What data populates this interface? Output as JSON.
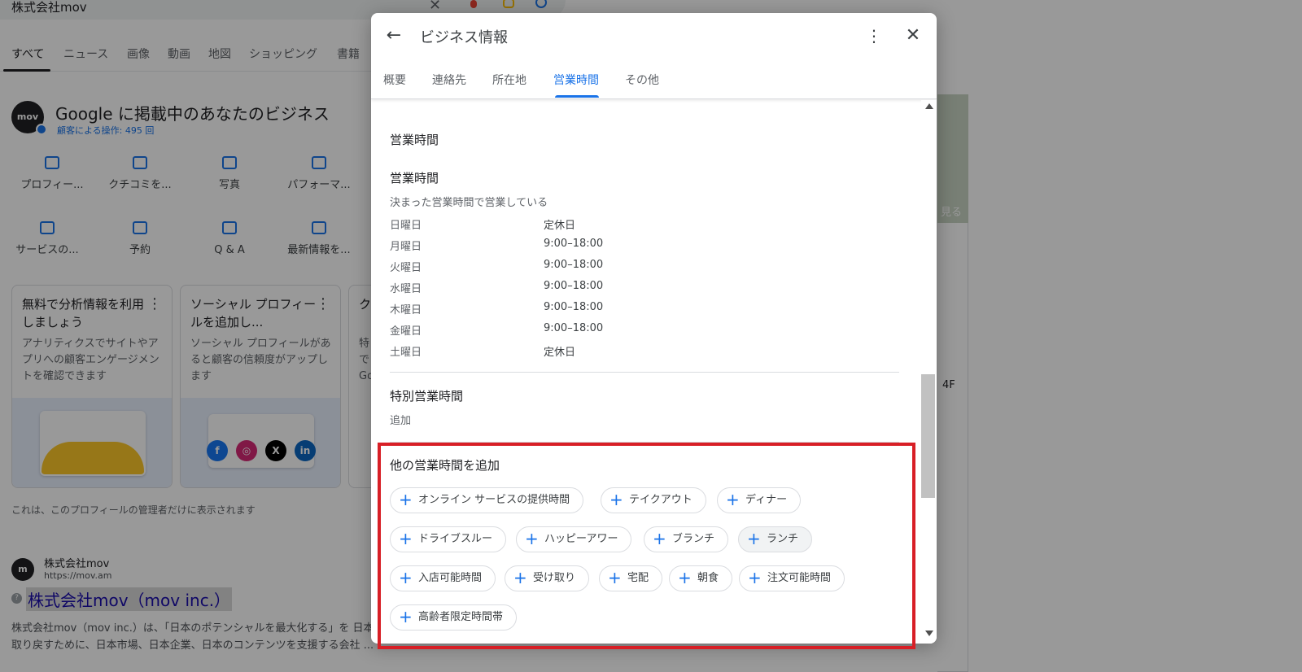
{
  "search": {
    "query": "株式会社mov"
  },
  "search_tabs": [
    "すべて",
    "ニュース",
    "画像",
    "動画",
    "地図",
    "ショッピング",
    "書籍"
  ],
  "business": {
    "avatar": "mov",
    "title": "Google に掲載中のあなたのビジネス",
    "stats": "顧客による操作: 495 回",
    "actions": [
      {
        "label": "プロフィー...",
        "icon": "storefront-icon"
      },
      {
        "label": "クチコミを...",
        "icon": "review-star-icon"
      },
      {
        "label": "写真",
        "icon": "photo-icon"
      },
      {
        "label": "パフォーマ...",
        "icon": "performance-icon"
      },
      {
        "label": "サービスの...",
        "icon": "list-icon"
      },
      {
        "label": "予約",
        "icon": "calendar-icon"
      },
      {
        "label": "Q & A",
        "icon": "qa-icon"
      },
      {
        "label": "最新情報を...",
        "icon": "post-add-icon"
      }
    ],
    "cards": [
      {
        "title": "無料で分析情報を利用しましょう",
        "desc": "アナリティクスでサイトやアプリへの顧客エンゲージメントを確認できます"
      },
      {
        "title": "ソーシャル プロフィールを追加し...",
        "desc": "ソーシャル プロフィールがあると顧客の信頼度がアップします"
      },
      {
        "title": "ク",
        "desc": "特で Go"
      }
    ],
    "admin_note": "これは、このプロフィールの管理者だけに表示されます"
  },
  "result": {
    "site_name": "株式会社mov",
    "url": "https://mov.am",
    "title": "株式会社mov（mov inc.）",
    "snippet": "株式会社mov（mov inc.）は、「日本のポテンシャルを最大化する」を 日本を取り戻すために、日本市場、日本企業、日本のコンテンツを支援する会社 ..."
  },
  "right_pane": {
    "map_link": "見る",
    "floor": "4F"
  },
  "dialog": {
    "title": "ビジネス情報",
    "tabs": [
      "概要",
      "連絡先",
      "所在地",
      "営業時間",
      "その他"
    ],
    "active_tab": "営業時間",
    "section_heading": "営業時間",
    "hours_heading": "営業時間",
    "hours_mode": "決まった営業時間で営業している",
    "hours": [
      {
        "day": "日曜日",
        "value": "定休日"
      },
      {
        "day": "月曜日",
        "value": "9:00–18:00"
      },
      {
        "day": "火曜日",
        "value": "9:00–18:00"
      },
      {
        "day": "水曜日",
        "value": "9:00–18:00"
      },
      {
        "day": "木曜日",
        "value": "9:00–18:00"
      },
      {
        "day": "金曜日",
        "value": "9:00–18:00"
      },
      {
        "day": "土曜日",
        "value": "定休日"
      }
    ],
    "special_heading": "特別営業時間",
    "special_add": "追加",
    "other_heading": "他の営業時間を追加",
    "other_hours_chips": [
      "オンライン サービスの提供時間",
      "テイクアウト",
      "ディナー",
      "ドライブスルー",
      "ハッピーアワー",
      "ブランチ",
      "ランチ",
      "入店可能時間",
      "受け取り",
      "宅配",
      "朝食",
      "注文可能時間",
      "高齢者限定時間帯"
    ]
  },
  "colors": {
    "accent": "#1a73e8",
    "highlight": "#d81f26"
  }
}
